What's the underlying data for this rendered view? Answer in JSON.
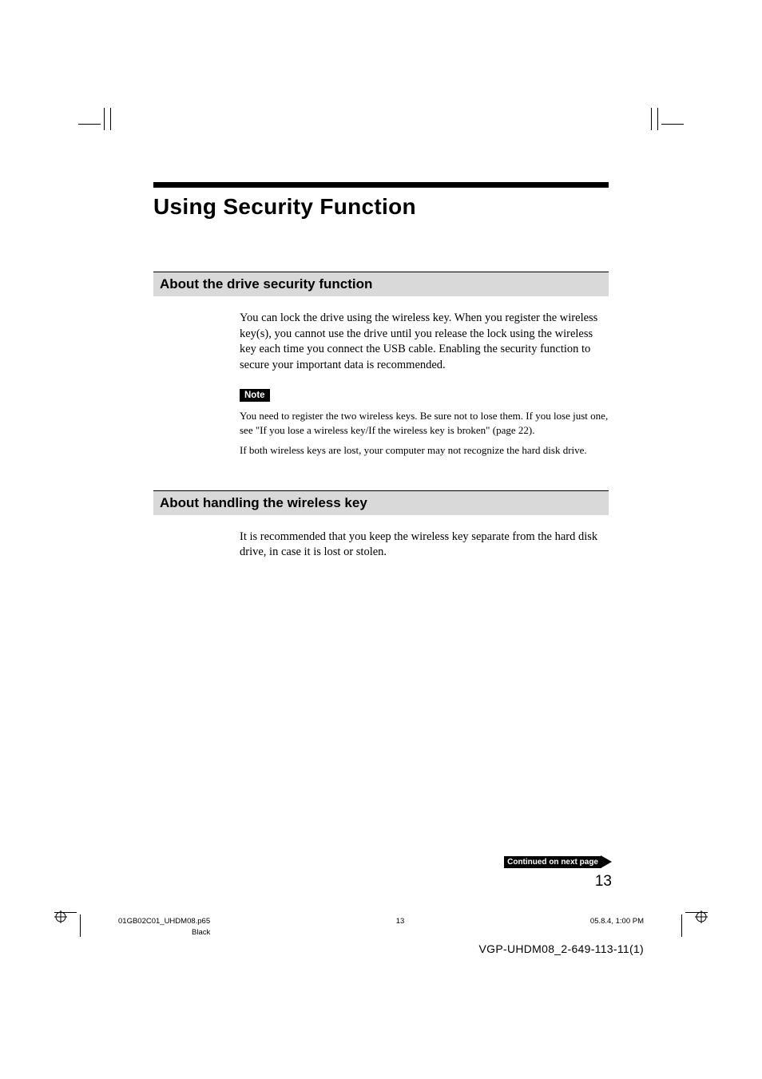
{
  "page": {
    "title": "Using Security Function",
    "number": "13",
    "continued_label": "Continued on next page"
  },
  "sections": {
    "s1": {
      "heading": "About the drive security function",
      "body": "You can lock the drive using the wireless key. When you register the wireless key(s), you cannot use the drive until you release the lock using the wireless key each time you connect the USB cable. Enabling the security function to secure your important data is recommended.",
      "note_label": "Note",
      "note1": "You need to register the two wireless keys. Be sure not to lose them. If you lose just one, see \"If you lose a wireless key/If the wireless key is broken\" (page 22).",
      "note2": "If both wireless keys are lost, your computer may not recognize the hard disk drive."
    },
    "s2": {
      "heading": "About handling the wireless key",
      "body": "It is recommended that you keep the wireless key separate from the hard disk drive,  in case it is lost or stolen."
    }
  },
  "footer": {
    "filename": "01GB02C01_UHDM08.p65",
    "page_small": "13",
    "timestamp": "05.8.4, 1:00 PM",
    "color": "Black",
    "doc_id": "VGP-UHDM08_2-649-113-11(1)"
  }
}
